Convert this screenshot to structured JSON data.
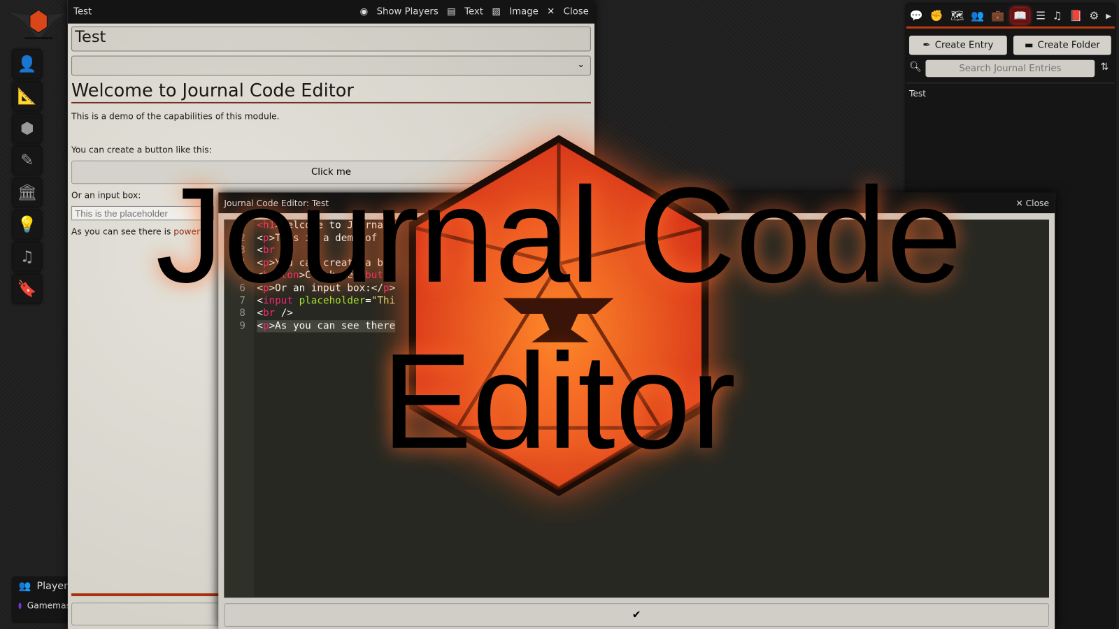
{
  "left_controls": {
    "icons": [
      "user-icon",
      "ruler-icon",
      "cubes-icon",
      "pencil-icon",
      "landmark-icon",
      "lightbulb-icon",
      "music-icon",
      "bookmark-icon"
    ]
  },
  "players": {
    "label": "Players",
    "users": [
      {
        "name": "Gamemaster",
        "color": "#7b2fd6"
      }
    ]
  },
  "journal": {
    "window_title": "Test",
    "actions": {
      "show_players": "Show Players",
      "text": "Text",
      "image": "Image",
      "close": "Close"
    },
    "name_value": "Test",
    "content": {
      "heading": "Welcome to Journal Code Editor",
      "intro": "This is a demo of the capabilities of this module.",
      "button_prompt": "You can create a button like this:",
      "button_label": "Click me",
      "input_prompt": "Or an input box:",
      "input_placeholder": "This is the placeholder",
      "closing_text": "As you can see there is ",
      "closing_link": "powerfu"
    }
  },
  "sidebar": {
    "tabs": [
      "chat-icon",
      "hand-fist-icon",
      "map-icon",
      "users-icon",
      "suitcase-icon",
      "book-open-icon",
      "table-list-icon",
      "music-icon",
      "compendium-icon",
      "cogs-icon",
      "caret-right-icon"
    ],
    "active_tab": "book-open-icon",
    "create_entry": "Create Entry",
    "create_folder": "Create Folder",
    "search_placeholder": "Search Journal Entries",
    "entries": [
      "Test"
    ]
  },
  "editor": {
    "title": "Journal Code Editor: Test",
    "close": "Close",
    "line_numbers": [
      "1",
      "2",
      "3",
      "4",
      "5",
      "6",
      "7",
      "8",
      "9"
    ],
    "lines": [
      [
        [
          "tg",
          "<h1"
        ],
        [
          "",
          "&gt;"
        ],
        [
          "",
          "Welcome to Journa"
        ]
      ],
      [
        [
          "",
          "<"
        ],
        [
          "tg",
          "p"
        ],
        [
          "",
          ">This is a demo of"
        ]
      ],
      [
        [
          "",
          "<"
        ],
        [
          "tg",
          "br"
        ],
        [
          "",
          ""
        ]
      ],
      [
        [
          "",
          "<"
        ],
        [
          "tg",
          "p"
        ],
        [
          "",
          ">You can create a b"
        ]
      ],
      [
        [
          "",
          "<"
        ],
        [
          "tg",
          "button"
        ],
        [
          "",
          ">Click me</"
        ],
        [
          "tg",
          "but"
        ]
      ],
      [
        [
          "",
          "<"
        ],
        [
          "tg",
          "p"
        ],
        [
          "",
          ">Or an input box:</"
        ],
        [
          "tg",
          "p"
        ],
        [
          "",
          ">"
        ]
      ],
      [
        [
          "",
          "<"
        ],
        [
          "tg",
          "input"
        ],
        [
          "",
          " "
        ],
        [
          "at",
          "placeholder"
        ],
        [
          "",
          "="
        ],
        [
          "st",
          "\"Thi"
        ]
      ],
      [
        [
          "",
          "<"
        ],
        [
          "tg",
          "br"
        ],
        [
          "",
          " />"
        ]
      ],
      [
        [
          "",
          "<"
        ],
        [
          "tg",
          "p"
        ],
        [
          "",
          ">As you can see there"
        ]
      ]
    ],
    "save_icon": "check-icon"
  },
  "logo": {
    "line1": "Journal Code",
    "line2": "Editor",
    "colors": {
      "glow": "#ff5a1a",
      "die": "#e8501e",
      "outline": "#1a0c06"
    }
  }
}
